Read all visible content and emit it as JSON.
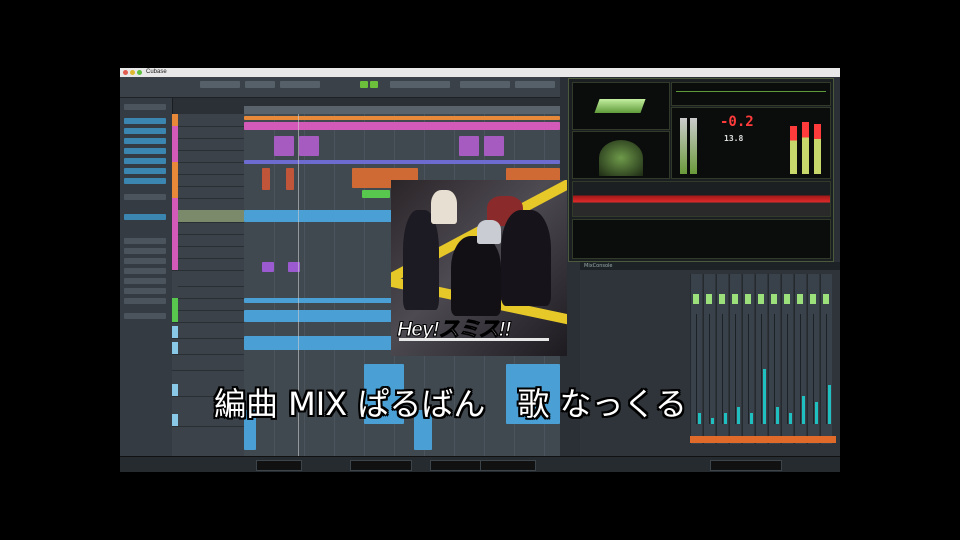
{
  "menubar": {
    "app_name": "Cubase",
    "status": ""
  },
  "meter": {
    "readout_main": "-0.2",
    "readout_small": "13.8",
    "accent": "#ff3b3b"
  },
  "mixer": {
    "title": "MixConsole",
    "vu_levels": [
      0.1,
      0.05,
      0.1,
      0.15,
      0.1,
      0.5,
      0.15,
      0.1,
      0.25,
      0.2,
      0.35
    ]
  },
  "cover": {
    "logo": "Hey!スミス!!"
  },
  "caption": {
    "text": "編曲 MIX ぱるばん　歌 なっくる"
  },
  "colors": {
    "pink": "#d35ab8",
    "orange": "#e8893a",
    "blue": "#4a9fd4",
    "green": "#57c84d",
    "lightblue": "#8ac8e8"
  }
}
